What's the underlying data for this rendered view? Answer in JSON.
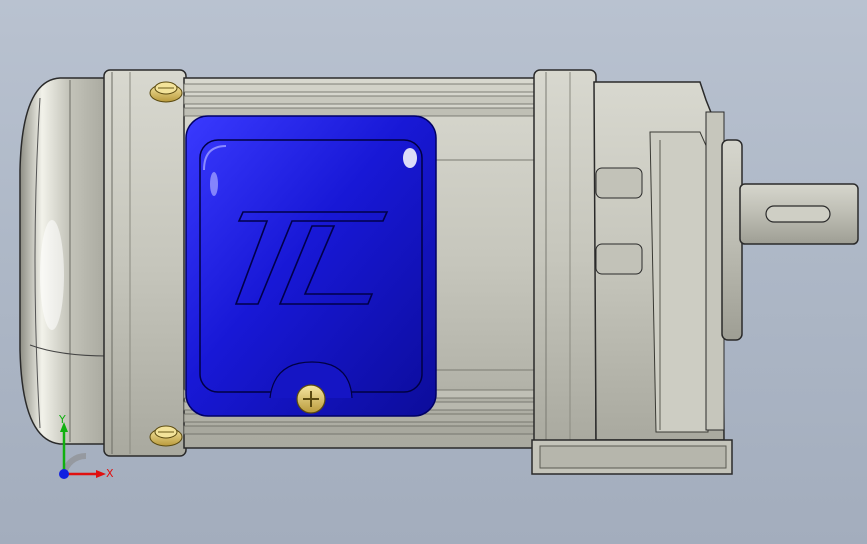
{
  "viewport": {
    "background_top": "#b9c2d0",
    "background_bottom": "#a3adbd"
  },
  "model": {
    "logo_text": "TL",
    "body_color": "#c9c9bf",
    "terminal_box_color": "#1a1ad8",
    "screw_color": "#d9c46a"
  },
  "triad": {
    "x_label": "X",
    "y_label": "Y",
    "x_color": "#e01010",
    "y_color": "#10b010",
    "z_color": "#1020e0"
  }
}
